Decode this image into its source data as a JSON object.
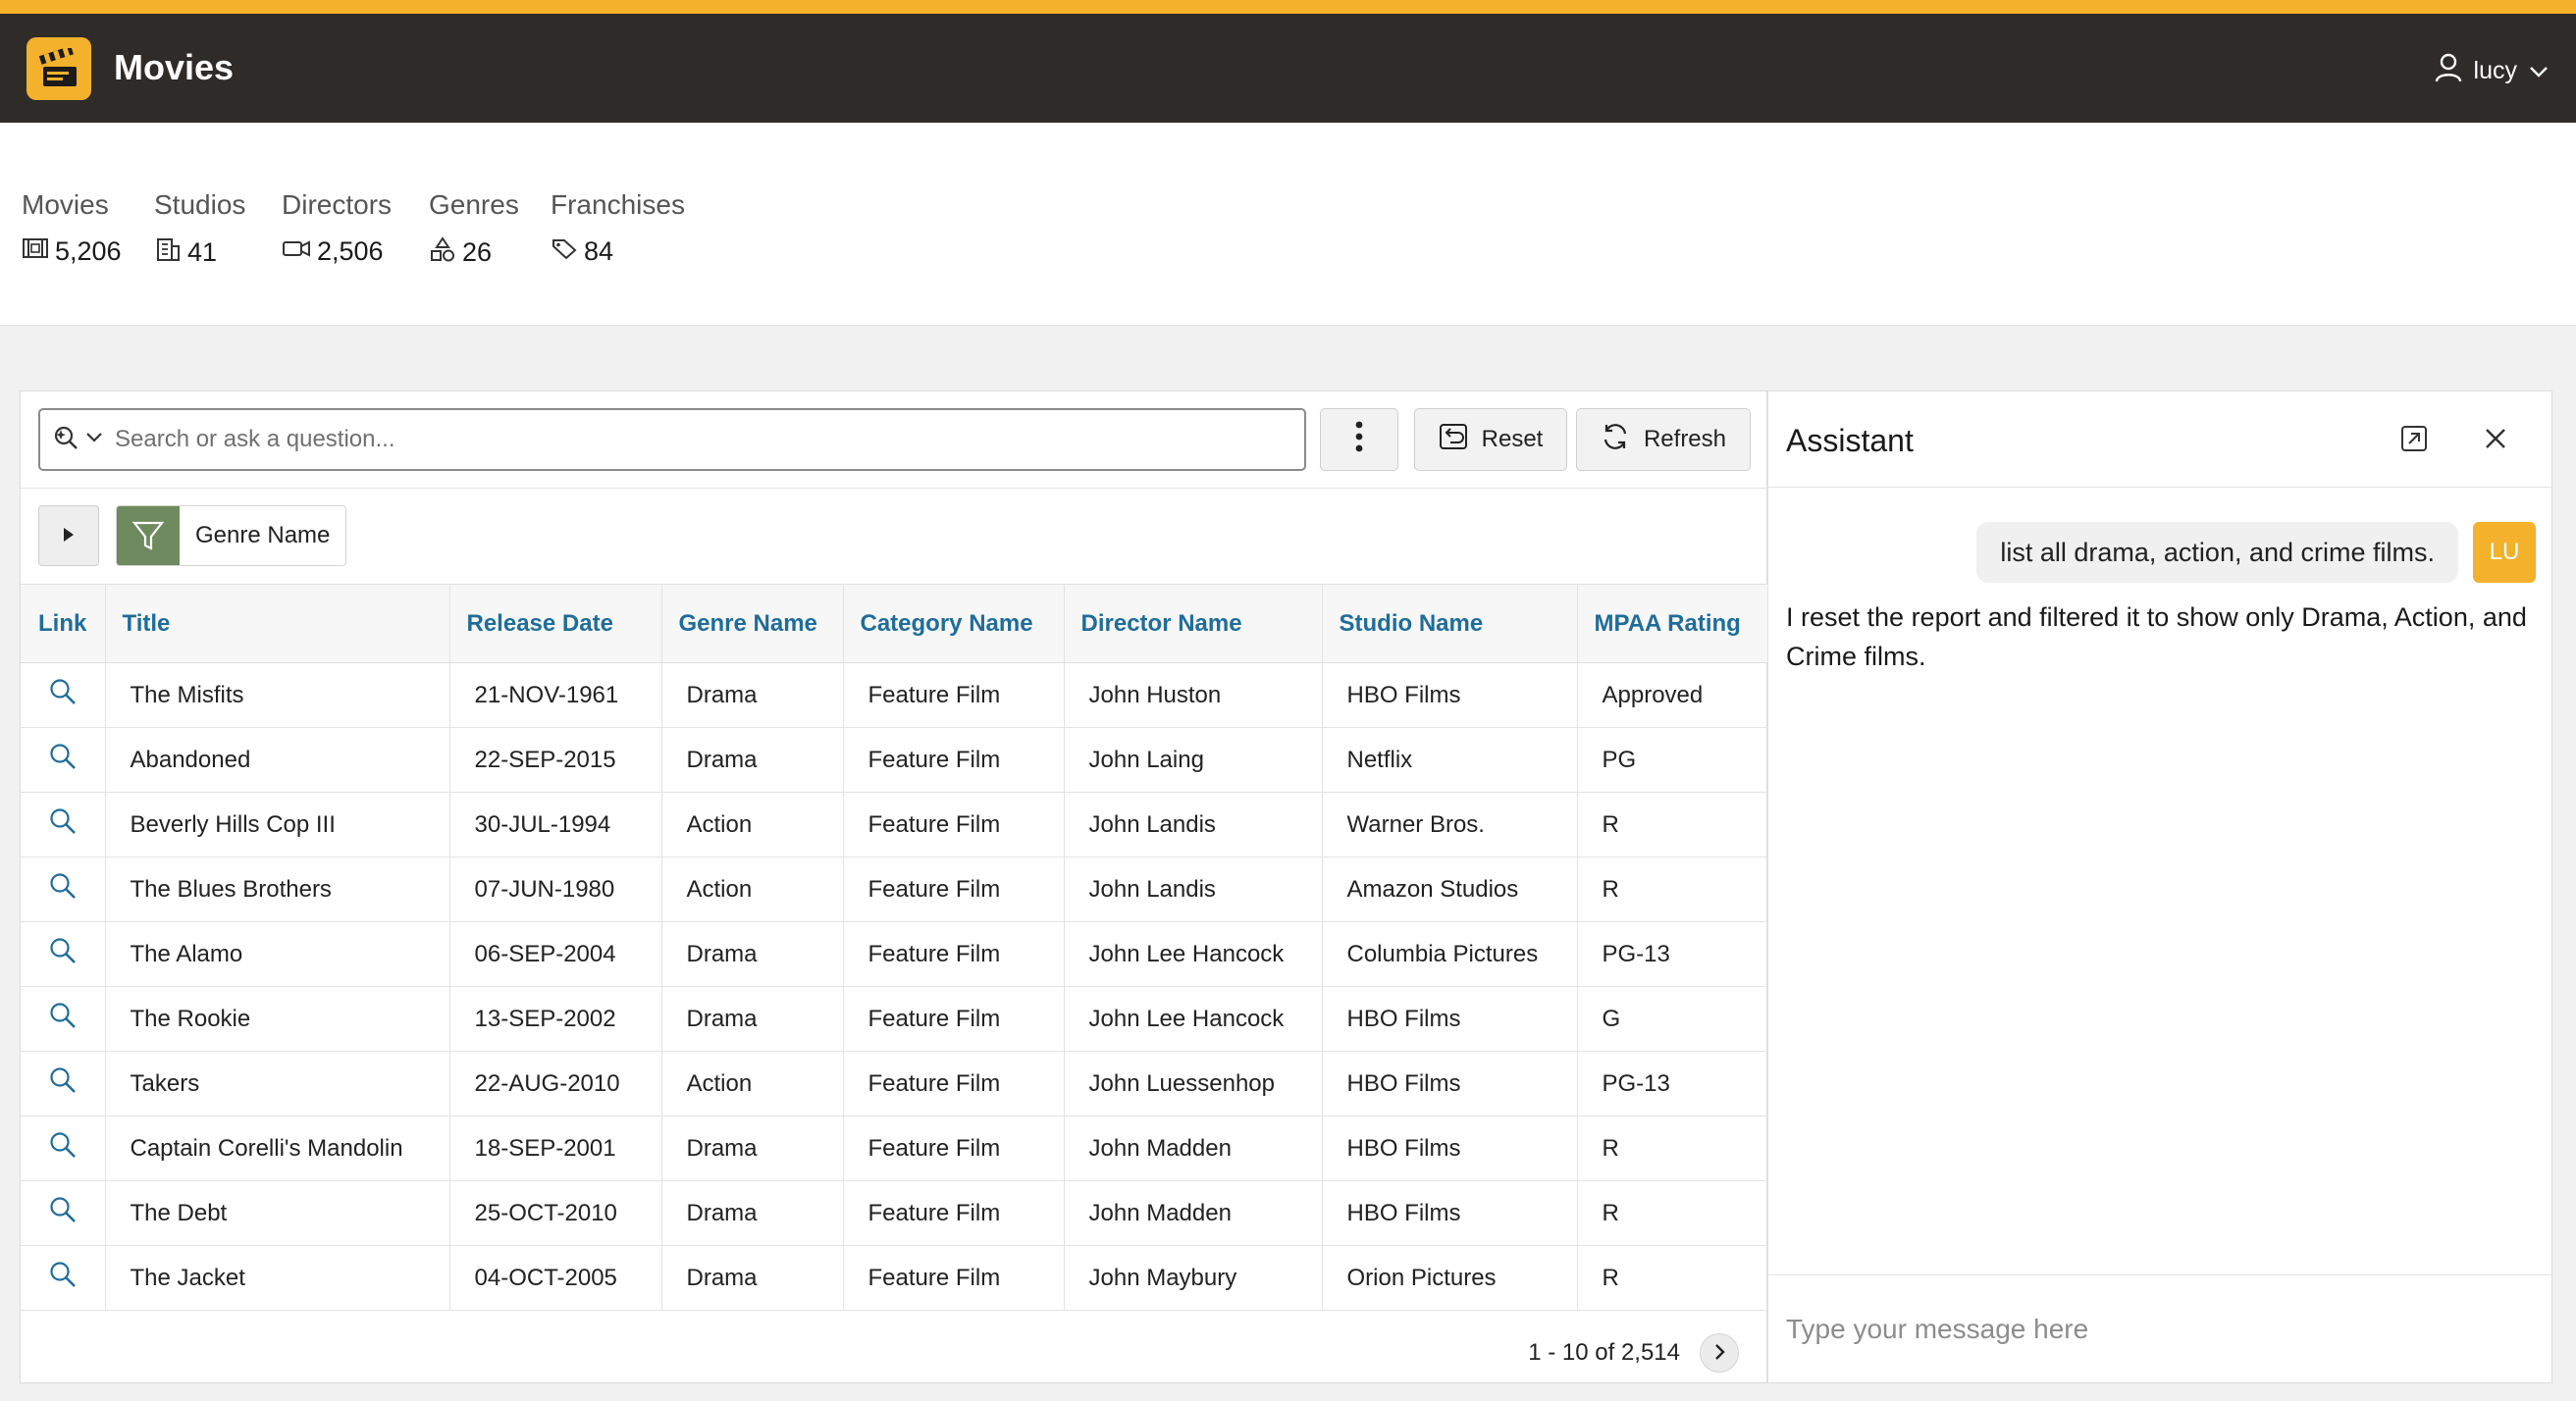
{
  "header": {
    "title": "Movies",
    "user": "lucy"
  },
  "stats": [
    {
      "label": "Movies",
      "value": "5,206",
      "icon": "film-icon"
    },
    {
      "label": "Studios",
      "value": "41",
      "icon": "building-icon"
    },
    {
      "label": "Directors",
      "value": "2,506",
      "icon": "video-camera-icon"
    },
    {
      "label": "Genres",
      "value": "26",
      "icon": "shapes-icon"
    },
    {
      "label": "Franchises",
      "value": "84",
      "icon": "tag-icon"
    }
  ],
  "toolbar": {
    "search_placeholder": "Search or ask a question...",
    "reset_label": "Reset",
    "refresh_label": "Refresh"
  },
  "filter": {
    "label": "Genre Name"
  },
  "table": {
    "columns": [
      "Link",
      "Title",
      "Release Date",
      "Genre Name",
      "Category Name",
      "Director Name",
      "Studio Name",
      "MPAA Rating"
    ],
    "rows": [
      [
        "The Misfits",
        "21-NOV-1961",
        "Drama",
        "Feature Film",
        "John Huston",
        "HBO Films",
        "Approved"
      ],
      [
        "Abandoned",
        "22-SEP-2015",
        "Drama",
        "Feature Film",
        "John Laing",
        "Netflix",
        "PG"
      ],
      [
        "Beverly Hills Cop III",
        "30-JUL-1994",
        "Action",
        "Feature Film",
        "John Landis",
        "Warner Bros.",
        "R"
      ],
      [
        "The Blues Brothers",
        "07-JUN-1980",
        "Action",
        "Feature Film",
        "John Landis",
        "Amazon Studios",
        "R"
      ],
      [
        "The Alamo",
        "06-SEP-2004",
        "Drama",
        "Feature Film",
        "John Lee Hancock",
        "Columbia Pictures",
        "PG-13"
      ],
      [
        "The Rookie",
        "13-SEP-2002",
        "Drama",
        "Feature Film",
        "John Lee Hancock",
        "HBO Films",
        "G"
      ],
      [
        "Takers",
        "22-AUG-2010",
        "Action",
        "Feature Film",
        "John Luessenhop",
        "HBO Films",
        "PG-13"
      ],
      [
        "Captain Corelli's Mandolin",
        "18-SEP-2001",
        "Drama",
        "Feature Film",
        "John Madden",
        "HBO Films",
        "R"
      ],
      [
        "The Debt",
        "25-OCT-2010",
        "Drama",
        "Feature Film",
        "John Madden",
        "HBO Films",
        "R"
      ],
      [
        "The Jacket",
        "04-OCT-2005",
        "Drama",
        "Feature Film",
        "John Maybury",
        "Orion Pictures",
        "R"
      ]
    ]
  },
  "pagination": {
    "text": "1 - 10 of 2,514"
  },
  "assistant": {
    "title": "Assistant",
    "user_message": "list all drama, action, and crime films.",
    "user_initials": "LU",
    "bot_message": "I reset the report and filtered it to show only Drama, Action, and Crime films.",
    "input_placeholder": "Type your message here"
  },
  "colors": {
    "accent": "#f4b12c",
    "header_bg": "#2f2b28",
    "link": "#1f6d9b",
    "filter": "#6f8a5e"
  }
}
